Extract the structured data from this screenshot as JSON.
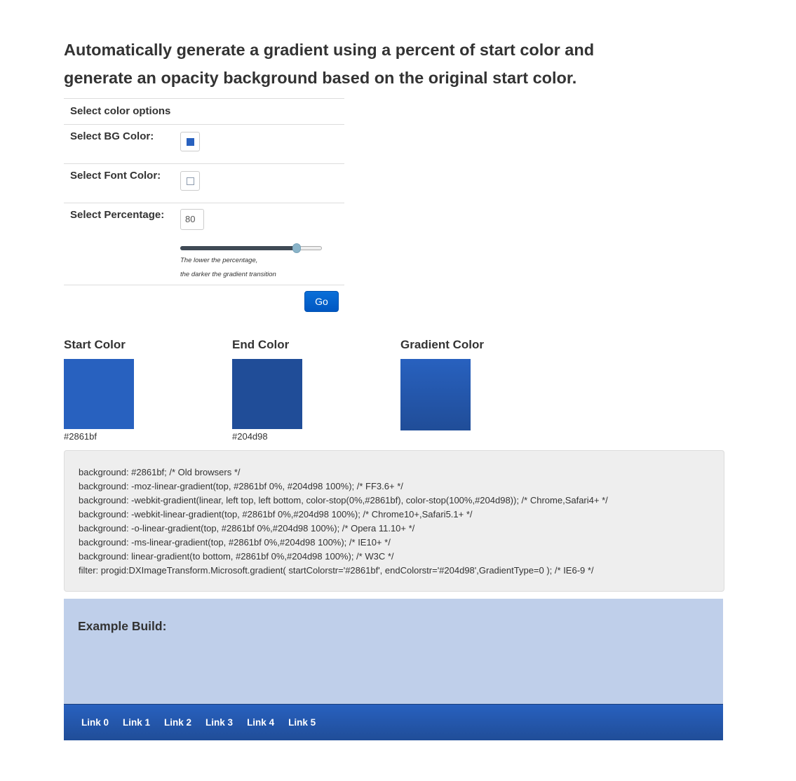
{
  "headline": "Automatically generate a gradient using a percent of start color and generate an opacity background based on the original start color.",
  "options": {
    "header": "Select color options",
    "bg_color_label": "Select BG Color:",
    "bg_color_value": "#2861bf",
    "font_color_label": "Select Font Color:",
    "font_color_value": "#ffffff",
    "percentage_label": "Select Percentage:",
    "percentage_value": "80",
    "slider_percent": 80,
    "hint_line1": "The lower the percentage,",
    "hint_line2": "the darker the gradient transition",
    "go_label": "Go"
  },
  "colors": {
    "start_title": "Start Color",
    "start_hex": "#2861bf",
    "end_title": "End Color",
    "end_hex": "#204d98",
    "gradient_title": "Gradient Color"
  },
  "css_code": [
    "background: #2861bf; /* Old browsers */",
    "background: -moz-linear-gradient(top, #2861bf 0%, #204d98 100%); /* FF3.6+ */",
    "background: -webkit-gradient(linear, left top, left bottom, color-stop(0%,#2861bf), color-stop(100%,#204d98)); /* Chrome,Safari4+ */",
    "background: -webkit-linear-gradient(top, #2861bf 0%,#204d98 100%); /* Chrome10+,Safari5.1+ */",
    "background: -o-linear-gradient(top, #2861bf 0%,#204d98 100%); /* Opera 11.10+ */",
    "background: -ms-linear-gradient(top, #2861bf 0%,#204d98 100%); /* IE10+ */",
    "background: linear-gradient(to bottom, #2861bf 0%,#204d98 100%); /* W3C */",
    "filter: progid:DXImageTransform.Microsoft.gradient( startColorstr='#2861bf', endColorstr='#204d98',GradientType=0 ); /* IE6-9 */"
  ],
  "example": {
    "title": "Example Build:",
    "background_color": "#bfcfea"
  },
  "nav": {
    "links": [
      "Link 0",
      "Link 1",
      "Link 2",
      "Link 3",
      "Link 4",
      "Link 5"
    ]
  },
  "theme": {
    "accent": "#0a6fd8"
  }
}
